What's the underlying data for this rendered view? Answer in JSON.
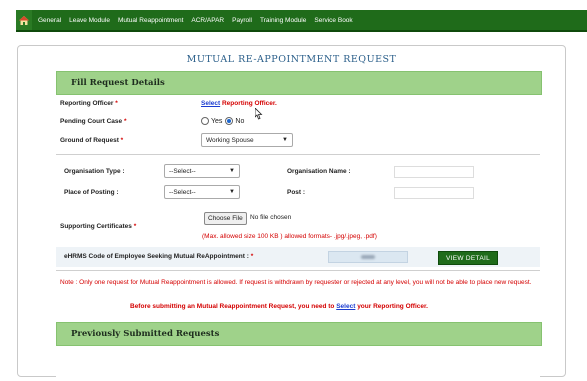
{
  "nav": {
    "items": [
      "General",
      "Leave Module",
      "Mutual Reappointment",
      "ACR/APAR",
      "Payroll",
      "Training Module",
      "Service Book"
    ]
  },
  "page": {
    "title": "MUTUAL RE-APPOINTMENT REQUEST"
  },
  "sections": {
    "fill": "Fill Request Details",
    "previous": "Previously Submitted Requests"
  },
  "form": {
    "reporting_officer_label": "Reporting Officer",
    "select_link": "Select",
    "reporting_officer_link": "Reporting Officer.",
    "pending_case_label": "Pending Court Case",
    "yes_label": "Yes",
    "no_label": "No",
    "ground_label": "Ground of Request",
    "ground_value": "Working Spouse",
    "org_type_label": "Organisation Type :",
    "org_type_value": "--Select--",
    "org_name_label": "Organisation Name :",
    "place_label": "Place of Posting :",
    "place_value": "--Select--",
    "post_label": "Post :",
    "certificates_label": "Supporting Certificates",
    "choose_file": "Choose File",
    "no_file": "No file chosen",
    "file_hint": "(Max. allowed size 100 KB ) allowed formats- .jpg/.jpeg, .pdf)",
    "ehrms_label": "eHRMS Code of Employee Seeking Mutual ReAppointment :",
    "view_detail": "VIEW DETAIL",
    "required_mark": "*"
  },
  "notes": {
    "note": "Note : Only one request for Mutual Reappointment is allowed. If request is withdrawn by requester or rejected at any level, you will not be able to place new request.",
    "before_prefix": "Before submitting an Mutual Reappointment Request, you need to",
    "before_link": "Select",
    "before_suffix": "your Reporting Officer."
  },
  "colors": {
    "nav_bg": "#1f6b1a",
    "header_bg": "#9fd28a",
    "title": "#2b5f8a",
    "accent_red": "#d40000",
    "link": "#1a3bd0"
  }
}
